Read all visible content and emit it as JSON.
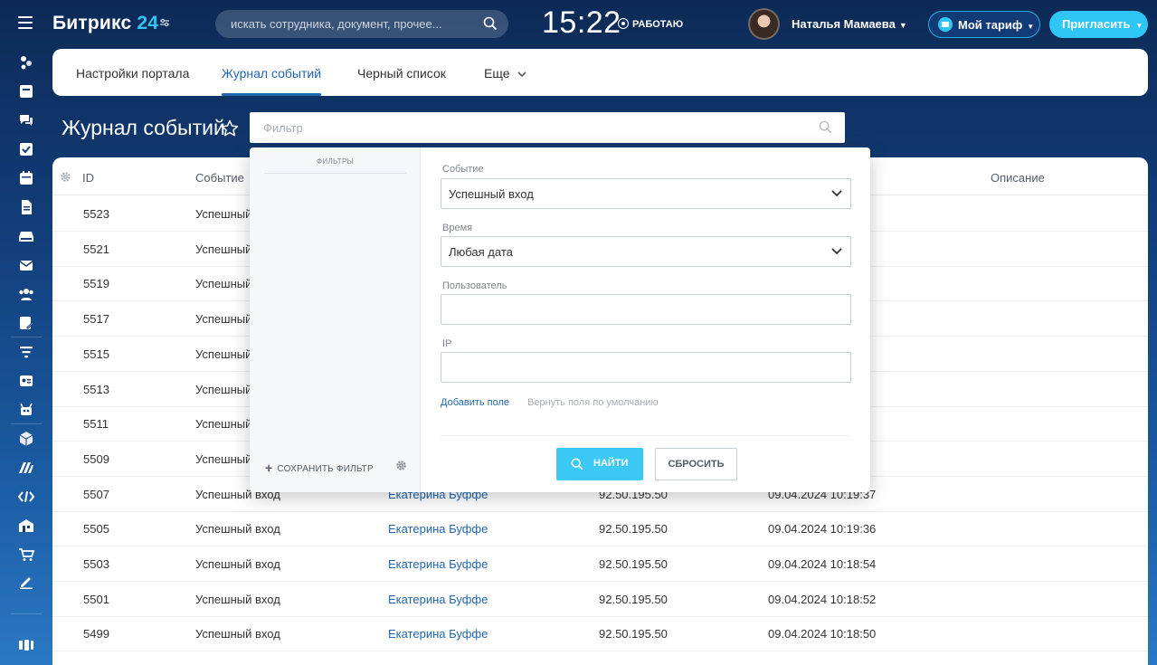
{
  "app": {
    "logo_name": "Битрикс",
    "logo_num": "24",
    "search_placeholder": "искать сотрудника, документ, прочее...",
    "clock": "15:22",
    "work_status": "РАБОТАЮ",
    "user_name": "Наталья Мамаева",
    "tariff_label": "Мой тариф",
    "invite_label": "Пригласить",
    "accent_color": "#2fc6f6"
  },
  "sidebar": {
    "icons": [
      "activity-stream-icon",
      "tasks-icon",
      "chat-icon",
      "checklist-icon",
      "calendar-icon",
      "documents-icon",
      "drive-icon",
      "mail-icon",
      "groups-icon",
      "forms-icon",
      "filter-icon",
      "contact-center-icon",
      "robots-icon",
      "box-icon",
      "marketing-icon",
      "developer-icon",
      "company-icon",
      "shop-icon",
      "sign-icon",
      "apps-icon"
    ]
  },
  "tabs": [
    {
      "label": "Настройки портала"
    },
    {
      "label": "Журнал событий"
    },
    {
      "label": "Черный список"
    },
    {
      "label": "Еще"
    }
  ],
  "page": {
    "title": "Журнал событий",
    "filter_placeholder": "Фильтр"
  },
  "table": {
    "columns": [
      "ID",
      "Событие",
      "Описание"
    ],
    "rows": [
      {
        "id": "5523",
        "event": "Успешный",
        "user": "",
        "ip": "",
        "time": ""
      },
      {
        "id": "5521",
        "event": "Успешный",
        "user": "",
        "ip": "",
        "time": ""
      },
      {
        "id": "5519",
        "event": "Успешный",
        "user": "",
        "ip": "",
        "time": ""
      },
      {
        "id": "5517",
        "event": "Успешный",
        "user": "",
        "ip": "",
        "time": ""
      },
      {
        "id": "5515",
        "event": "Успешный",
        "user": "",
        "ip": "",
        "time": ""
      },
      {
        "id": "5513",
        "event": "Успешный",
        "user": "",
        "ip": "",
        "time": ""
      },
      {
        "id": "5511",
        "event": "Успешный",
        "user": "",
        "ip": "",
        "time": ""
      },
      {
        "id": "5509",
        "event": "Успешный",
        "user": "",
        "ip": "",
        "time": ""
      },
      {
        "id": "5507",
        "event": "Успешный вход",
        "user": "Екатерина Буффе",
        "ip": "92.50.195.50",
        "time": "09.04.2024 10:19:37"
      },
      {
        "id": "5505",
        "event": "Успешный вход",
        "user": "Екатерина Буффе",
        "ip": "92.50.195.50",
        "time": "09.04.2024 10:19:36"
      },
      {
        "id": "5503",
        "event": "Успешный вход",
        "user": "Екатерина Буффе",
        "ip": "92.50.195.50",
        "time": "09.04.2024 10:18:54"
      },
      {
        "id": "5501",
        "event": "Успешный вход",
        "user": "Екатерина Буффе",
        "ip": "92.50.195.50",
        "time": "09.04.2024 10:18:52"
      },
      {
        "id": "5499",
        "event": "Успешный вход",
        "user": "Екатерина Буффе",
        "ip": "92.50.195.50",
        "time": "09.04.2024 10:18:50"
      }
    ]
  },
  "filter_popup": {
    "presets_title": "ФИЛЬТРЫ",
    "save_filter": "СОХРАНИТЬ ФИЛЬТР",
    "event_label": "Событие",
    "event_value": "Успешный вход",
    "time_label": "Время",
    "time_value": "Любая дата",
    "user_label": "Пользователь",
    "user_value": "",
    "ip_label": "IP",
    "ip_value": "",
    "add_field": "Добавить поле",
    "reset_fields": "Вернуть поля по умолчанию",
    "find_button": "НАЙТИ",
    "reset_button": "СБРОСИТЬ"
  }
}
